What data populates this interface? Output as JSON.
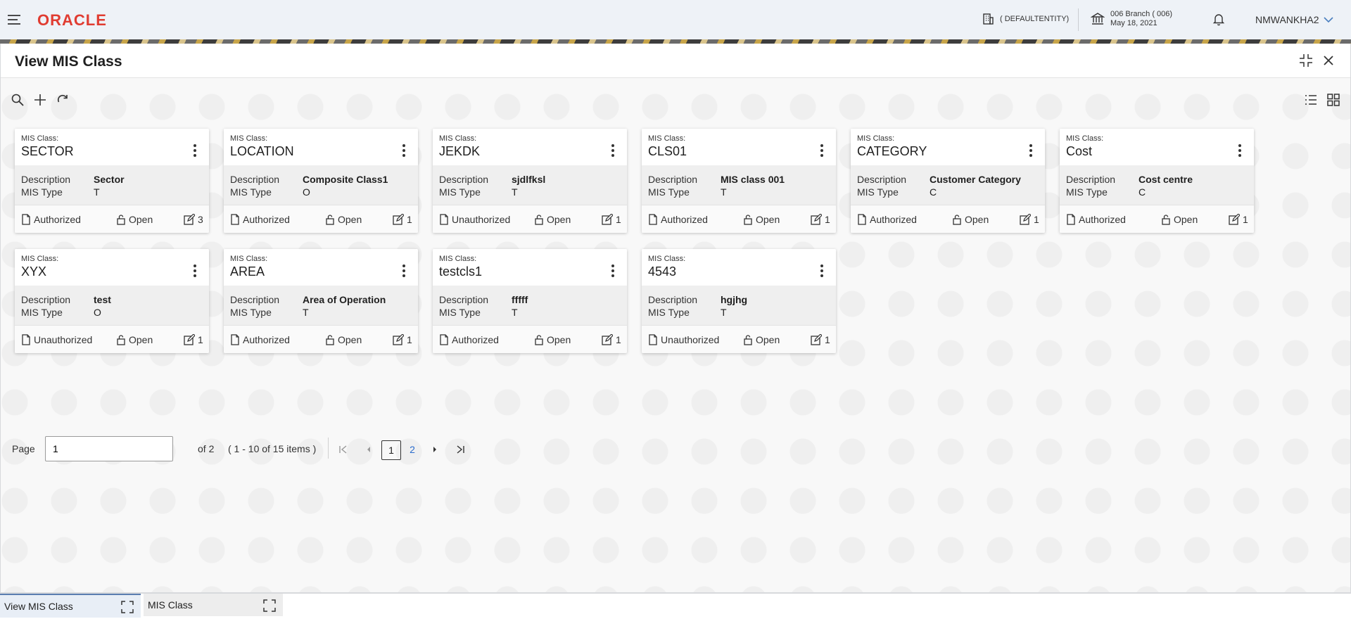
{
  "header": {
    "logo": "ORACLE",
    "entity": "( DEFAULTENTITY)",
    "branch_line1": "006 Branch ( 006)",
    "branch_line2": "May 18, 2021",
    "user": "NMWANKHA2"
  },
  "panel": {
    "title": "View MIS Class"
  },
  "cards": [
    {
      "label": "MIS Class:",
      "id": "SECTOR",
      "desc_label": "Description",
      "desc": "Sector",
      "type_label": "MIS Type",
      "type": "T",
      "auth": "Authorized",
      "status": "Open",
      "count": "3"
    },
    {
      "label": "MIS Class:",
      "id": "LOCATION",
      "desc_label": "Description",
      "desc": "Composite Class1",
      "type_label": "MIS Type",
      "type": "O",
      "auth": "Authorized",
      "status": "Open",
      "count": "1"
    },
    {
      "label": "MIS Class:",
      "id": "JEKDK",
      "desc_label": "Description",
      "desc": "sjdlfksl",
      "type_label": "MIS Type",
      "type": "T",
      "auth": "Unauthorized",
      "status": "Open",
      "count": "1"
    },
    {
      "label": "MIS Class:",
      "id": "CLS01",
      "desc_label": "Description",
      "desc": "MIS class 001",
      "type_label": "MIS Type",
      "type": "T",
      "auth": "Authorized",
      "status": "Open",
      "count": "1"
    },
    {
      "label": "MIS Class:",
      "id": "CATEGORY",
      "desc_label": "Description",
      "desc": "Customer Category",
      "type_label": "MIS Type",
      "type": "C",
      "auth": "Authorized",
      "status": "Open",
      "count": "1"
    },
    {
      "label": "MIS Class:",
      "id": "Cost",
      "desc_label": "Description",
      "desc": "Cost centre",
      "type_label": "MIS Type",
      "type": "C",
      "auth": "Authorized",
      "status": "Open",
      "count": "1"
    },
    {
      "label": "MIS Class:",
      "id": "XYX",
      "desc_label": "Description",
      "desc": "test",
      "type_label": "MIS Type",
      "type": "O",
      "auth": "Unauthorized",
      "status": "Open",
      "count": "1"
    },
    {
      "label": "MIS Class:",
      "id": "AREA",
      "desc_label": "Description",
      "desc": "Area of Operation",
      "type_label": "MIS Type",
      "type": "T",
      "auth": "Authorized",
      "status": "Open",
      "count": "1"
    },
    {
      "label": "MIS Class:",
      "id": "testcls1",
      "desc_label": "Description",
      "desc": "fffff",
      "type_label": "MIS Type",
      "type": "T",
      "auth": "Authorized",
      "status": "Open",
      "count": "1"
    },
    {
      "label": "MIS Class:",
      "id": "4543",
      "desc_label": "Description",
      "desc": "hgjhg",
      "type_label": "MIS Type",
      "type": "T",
      "auth": "Unauthorized",
      "status": "Open",
      "count": "1"
    }
  ],
  "pager": {
    "label": "Page",
    "current": "1",
    "of": "of 2",
    "range": "( 1 - 10 of 15 items )",
    "pages": [
      "1",
      "2"
    ]
  },
  "bottom_tabs": [
    {
      "label": "View MIS Class"
    },
    {
      "label": "MIS Class"
    }
  ],
  "icons": [
    "menu-icon",
    "building-icon",
    "bank-icon",
    "bell-icon",
    "chevron-down-icon",
    "minimize-icon",
    "close-icon",
    "search-icon",
    "plus-icon",
    "refresh-icon",
    "list-view-icon",
    "grid-view-icon",
    "kebab-icon",
    "document-icon",
    "unlock-icon",
    "edit-icon",
    "first-page-icon",
    "prev-page-icon",
    "next-page-icon",
    "last-page-icon",
    "expand-icon"
  ],
  "colors": {
    "brand": "#e03c31",
    "link": "#2b6ccc",
    "card_mid": "#efefef",
    "header_bg": "#eef2f7"
  }
}
